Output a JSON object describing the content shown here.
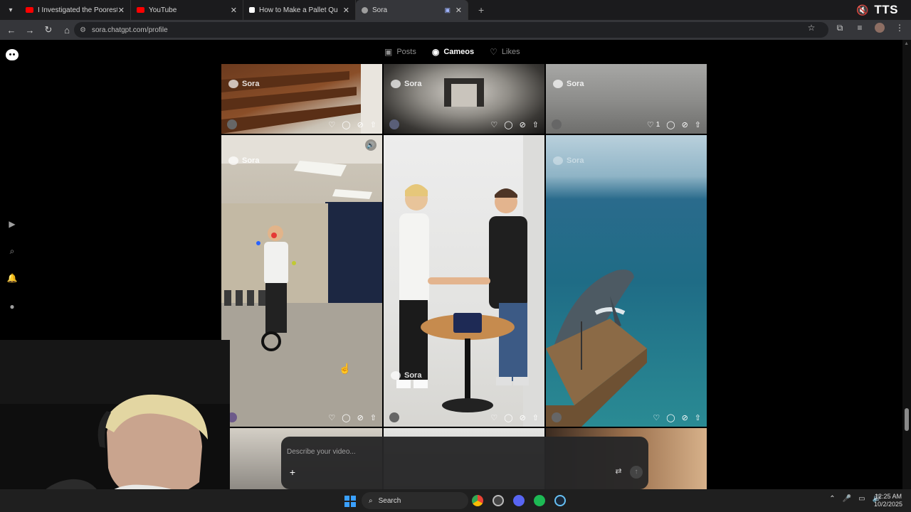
{
  "browser": {
    "tabs": [
      {
        "title": "I Investigated the Poorest Town",
        "favicon": "youtube-icon",
        "color": "#ff0000"
      },
      {
        "title": "YouTube",
        "favicon": "youtube-icon",
        "color": "#ff0000"
      },
      {
        "title": "How to Make a Pallet Quickly a",
        "favicon": "tiktok-icon",
        "color": "#ffffff"
      },
      {
        "title": "Sora",
        "favicon": "sora-icon",
        "color": "#9e9e9e",
        "active": true
      }
    ],
    "url": "sora.chatgpt.com/profile",
    "extension_label": "TTS"
  },
  "profile": {
    "tabs": [
      {
        "label": "Posts",
        "icon": "play-square-icon",
        "active": false
      },
      {
        "label": "Cameos",
        "icon": "user-circle-icon",
        "active": true
      },
      {
        "label": "Likes",
        "icon": "heart-icon",
        "active": false
      }
    ]
  },
  "grid": {
    "watermark": "Sora",
    "top_row": [
      {
        "likes": "",
        "scene": "stairs"
      },
      {
        "likes": "",
        "scene": "hallway"
      },
      {
        "likes": "1",
        "scene": "fog"
      }
    ],
    "main_row": [
      {
        "scene": "unicycle juggler",
        "watermark_position": "top"
      },
      {
        "scene": "handshake table",
        "watermark_position": "bottom"
      },
      {
        "scene": "shark ocean dock",
        "watermark_position": "top"
      }
    ]
  },
  "composer": {
    "placeholder": "Describe your video..."
  },
  "taskbar": {
    "search_label": "Search",
    "time": "12:25 AM",
    "date": "10/2/2025"
  }
}
